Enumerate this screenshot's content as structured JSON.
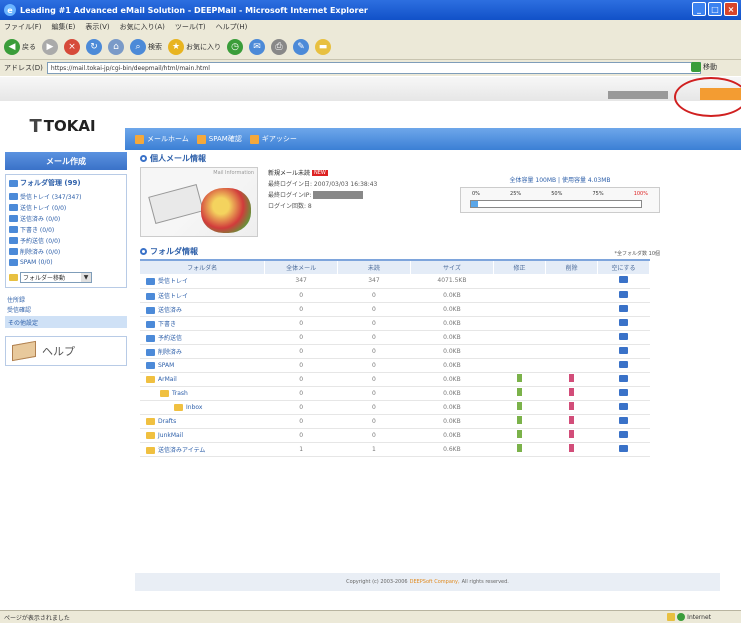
{
  "window": {
    "title": "Leading #1 Advanced eMail Solution - DEEPMail - Microsoft Internet Explorer"
  },
  "menu": [
    "ファイル(F)",
    "編集(E)",
    "表示(V)",
    "お気に入り(A)",
    "ツール(T)",
    "ヘルプ(H)"
  ],
  "toolbar": {
    "back": "戻る",
    "search": "検索",
    "favorites": "お気に入り"
  },
  "address": {
    "label": "アドレス(D)",
    "url": "https://mail.tokai-jp/cgi-bin/deepmail/html/main.html",
    "go": "移動"
  },
  "logo": "TOKAI",
  "nav": [
    "メールホーム",
    "SPAM確認",
    "ギアッシー"
  ],
  "sidebar": {
    "compose": "メール作成",
    "folder_header": "フォルダ管理 (99)",
    "folders": [
      "受信トレイ (347/347)",
      "送信トレイ (0/0)",
      "送信済み (0/0)",
      "下書き (0/0)",
      "予約送信 (0/0)",
      "削除済み (0/0)",
      "SPAM (0/0)"
    ],
    "folder_select": "フォルダー移動",
    "links": [
      "住所録",
      "受信確認"
    ],
    "highlight": "その他設定",
    "help": "ヘルプ"
  },
  "personal": {
    "title": "個人メール情報",
    "img_label": "Mail Information",
    "new_mail": "新規メール未読",
    "new_label": "NEW",
    "last_login": "最終ログイン日: 2007/03/03 16:38:43",
    "last_login_ip": "最終ログインIP:",
    "login_count": "ログイン回数: 8",
    "capacity_text": "全体容量 100MB | 使用容量 4.03MB",
    "scale": [
      "0%",
      "25%",
      "50%",
      "75%",
      "100%"
    ],
    "usage_fraction": 0.04
  },
  "folders_section": {
    "title": "フォルダ情報",
    "count": "*全フォルダ数 10個",
    "headers": [
      "フォルダ名",
      "全体メール",
      "未読",
      "サイズ",
      "修正",
      "削除",
      "空にする"
    ],
    "rows": [
      {
        "name": "受信トレイ",
        "total": "347",
        "unread": "347",
        "size": "4071.5KB",
        "edit": false,
        "del": false,
        "indent": 0,
        "yellow": false
      },
      {
        "name": "送信トレイ",
        "total": "0",
        "unread": "0",
        "size": "0.0KB",
        "edit": false,
        "del": false,
        "indent": 0,
        "yellow": false
      },
      {
        "name": "送信済み",
        "total": "0",
        "unread": "0",
        "size": "0.0KB",
        "edit": false,
        "del": false,
        "indent": 0,
        "yellow": false
      },
      {
        "name": "下書き",
        "total": "0",
        "unread": "0",
        "size": "0.0KB",
        "edit": false,
        "del": false,
        "indent": 0,
        "yellow": false
      },
      {
        "name": "予約送信",
        "total": "0",
        "unread": "0",
        "size": "0.0KB",
        "edit": false,
        "del": false,
        "indent": 0,
        "yellow": false
      },
      {
        "name": "削除済み",
        "total": "0",
        "unread": "0",
        "size": "0.0KB",
        "edit": false,
        "del": false,
        "indent": 0,
        "yellow": false
      },
      {
        "name": "SPAM",
        "total": "0",
        "unread": "0",
        "size": "0.0KB",
        "edit": false,
        "del": false,
        "indent": 0,
        "yellow": false
      },
      {
        "name": "ArMail",
        "total": "0",
        "unread": "0",
        "size": "0.0KB",
        "edit": true,
        "del": true,
        "indent": 0,
        "yellow": true
      },
      {
        "name": "Trash",
        "total": "0",
        "unread": "0",
        "size": "0.0KB",
        "edit": true,
        "del": true,
        "indent": 1,
        "yellow": true
      },
      {
        "name": "Inbox",
        "total": "0",
        "unread": "0",
        "size": "0.0KB",
        "edit": true,
        "del": true,
        "indent": 2,
        "yellow": true
      },
      {
        "name": "Drafts",
        "total": "0",
        "unread": "0",
        "size": "0.0KB",
        "edit": true,
        "del": true,
        "indent": 0,
        "yellow": true
      },
      {
        "name": "JunkMail",
        "total": "0",
        "unread": "0",
        "size": "0.0KB",
        "edit": true,
        "del": true,
        "indent": 0,
        "yellow": true
      },
      {
        "name": "送信済みアイテム",
        "total": "1",
        "unread": "1",
        "size": "0.6KB",
        "edit": true,
        "del": true,
        "indent": 0,
        "yellow": true
      }
    ]
  },
  "footer": {
    "prefix": "Copyright (c) 2003-2006",
    "org": "DEEPSoft Company,",
    "suffix": "All rights reserved."
  },
  "status": {
    "left": "ページが表示されました",
    "zone": "Internet"
  },
  "colors": {
    "accent": "#3a72c8",
    "nav": "#5b92e0",
    "highlight": "#cfe1f6",
    "red": "#d02020"
  }
}
